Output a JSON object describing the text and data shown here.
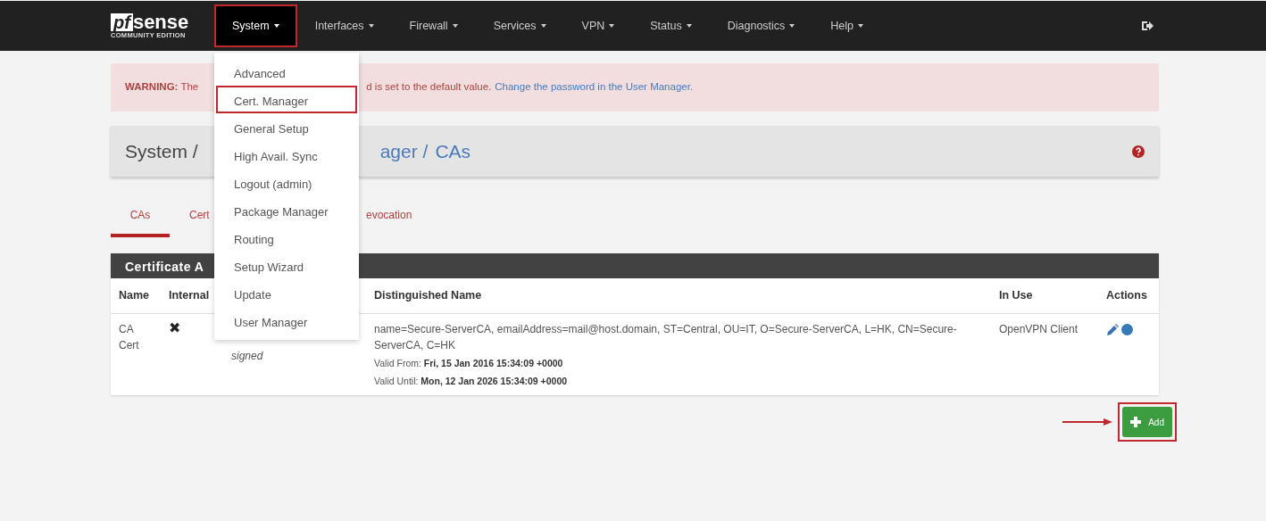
{
  "navbar": {
    "logo": {
      "mark": "pf",
      "name": "sense",
      "edition": "COMMUNITY EDITION"
    },
    "items": [
      {
        "label": "System",
        "selected": true,
        "highlighted": true
      },
      {
        "label": "Interfaces",
        "selected": false,
        "highlighted": false
      },
      {
        "label": "Firewall",
        "selected": false,
        "highlighted": false
      },
      {
        "label": "Services",
        "selected": false,
        "highlighted": false
      },
      {
        "label": "VPN",
        "selected": false,
        "highlighted": false
      },
      {
        "label": "Status",
        "selected": false,
        "highlighted": false
      },
      {
        "label": "Diagnostics",
        "selected": false,
        "highlighted": false
      },
      {
        "label": "Help",
        "selected": false,
        "highlighted": false
      }
    ]
  },
  "dropdown": {
    "items": [
      {
        "label": "Advanced",
        "highlighted": false
      },
      {
        "label": "Cert. Manager",
        "highlighted": true
      },
      {
        "label": "General Setup",
        "highlighted": false
      },
      {
        "label": "High Avail. Sync",
        "highlighted": false
      },
      {
        "label": "Logout (admin)",
        "highlighted": false
      },
      {
        "label": "Package Manager",
        "highlighted": false
      },
      {
        "label": "Routing",
        "highlighted": false
      },
      {
        "label": "Setup Wizard",
        "highlighted": false
      },
      {
        "label": "Update",
        "highlighted": false
      },
      {
        "label": "User Manager",
        "highlighted": false
      }
    ]
  },
  "alert": {
    "start": "**WARNING:** The",
    "end": "d is set to the default value.",
    "link": "Change the password in the User Manager."
  },
  "breadcrumb": {
    "start": "System /",
    "end": "ager /",
    "current": "CAs"
  },
  "tabs": [
    {
      "label": "CAs",
      "selected": true
    },
    {
      "label": "Cert",
      "selected": false
    },
    {
      "label": "evocation",
      "selected": false
    }
  ],
  "panel": {
    "title": "Certificate A",
    "columns": {
      "name": "Name",
      "internal": "Internal",
      "distinguished_name": "Distinguished Name",
      "in_use": "In Use",
      "actions": "Actions"
    },
    "rows": [
      {
        "name": "CA Cert",
        "internal_mark": "✖",
        "issuer": "signed",
        "distinguished_name": "name=Secure-ServerCA, emailAddress=mail@host.domain, ST=Central, OU=IT, O=Secure-ServerCA, L=HK, CN=Secure-ServerCA, C=HK",
        "valid_from": "Valid From: **Fri, 15 Jan 2016 15:34:09 +0000**",
        "valid_until": "Valid Until: **Mon, 12 Jan 2026 15:34:09 +0000**",
        "in_use": "OpenVPN Client"
      }
    ]
  },
  "add_button": {
    "label": "Add",
    "highlighted": true
  }
}
